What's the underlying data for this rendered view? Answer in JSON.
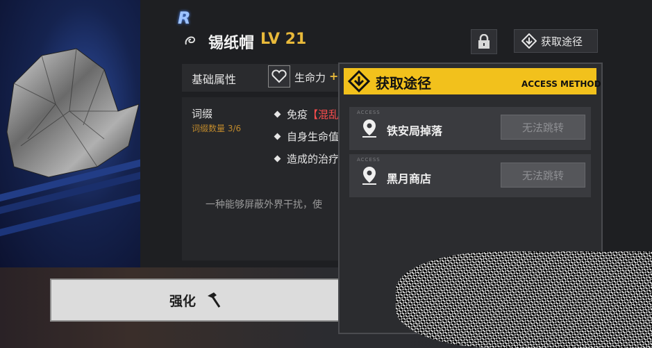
{
  "rarity": "R",
  "item": {
    "name": "锡纸帽",
    "level": "LV 21"
  },
  "header_buttons": {
    "source_label": "获取途径"
  },
  "stats": {
    "section_label": "基础属性",
    "hp_label": "生命力",
    "hp_suffix": "+"
  },
  "affix": {
    "title": "词缀",
    "count": "词缀数量 3/6",
    "items": [
      {
        "prefix": "免疫",
        "highlight": "【混乱"
      },
      {
        "prefix": "自身生命值"
      },
      {
        "prefix": "造成的治疗"
      }
    ]
  },
  "description": "一种能够屏蔽外界干扰，使",
  "enhance": {
    "label": "强化"
  },
  "access_popup": {
    "title": "获取途径",
    "subtitle": "ACCESS METHOD",
    "routes": [
      {
        "tag": "ACCESS",
        "name": "铁安局掉落",
        "button": "无法跳转"
      },
      {
        "tag": "ACCESS",
        "name": "黑月商店",
        "button": "无法跳转"
      }
    ]
  },
  "colors": {
    "accent": "#f2c11c",
    "level": "#e8b93a",
    "warning": "#ff4d4d"
  }
}
